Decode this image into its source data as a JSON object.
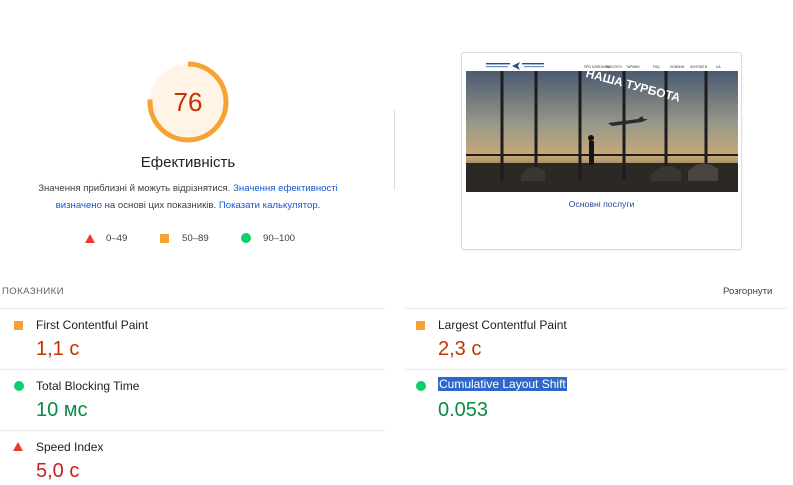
{
  "summary": {
    "score": "76",
    "category": "Ефективність",
    "description_prefix": "Значення приблизні й можуть відрізнятися.",
    "description_link1_line1": "Значення ефективності",
    "description_link1_line2": "визначено",
    "description_middle": "на основі цих показників.",
    "description_link2": "Показати калькулятор",
    "description_end": ".",
    "score_fraction": 0.76,
    "gauge_color": "#f6a234",
    "gauge_bg": "#fff4e5"
  },
  "legend": [
    {
      "icon": "triangle-icon",
      "label": "0–49",
      "color": "#eb3b31"
    },
    {
      "icon": "square-icon",
      "label": "50–89",
      "color": "#f6a234"
    },
    {
      "icon": "circle-icon",
      "label": "90–100",
      "color": "#0cce6b"
    }
  ],
  "thumbnail": {
    "logo_text_1": "ДОРОЖНЯ",
    "logo_text_2": "ТУРБОТА",
    "nav_items": [
      "ПРО КОМПАНІЮ",
      "ПОСЛУГИ",
      "ТАРИФИ",
      "FAQ",
      "НОВИНИ",
      "КОНТАКТИ",
      "UA"
    ],
    "hero_text": "НАША ТУРБОТА",
    "caption": "Основні послуги"
  },
  "metrics_section": {
    "title": "ПОКАЗНИКИ",
    "toggle": "Розгорнути"
  },
  "metrics": [
    {
      "name": "First Contentful Paint",
      "value": "1,1 с",
      "status": "average"
    },
    {
      "name": "Largest Contentful Paint",
      "value": "2,3 с",
      "status": "average"
    },
    {
      "name": "Total Blocking Time",
      "value": "10 мс",
      "status": "pass"
    },
    {
      "name": "Cumulative Layout Shift",
      "value": "0.053",
      "status": "pass"
    },
    {
      "name": "Speed Index",
      "value": "5,0 с",
      "status": "fail"
    }
  ]
}
